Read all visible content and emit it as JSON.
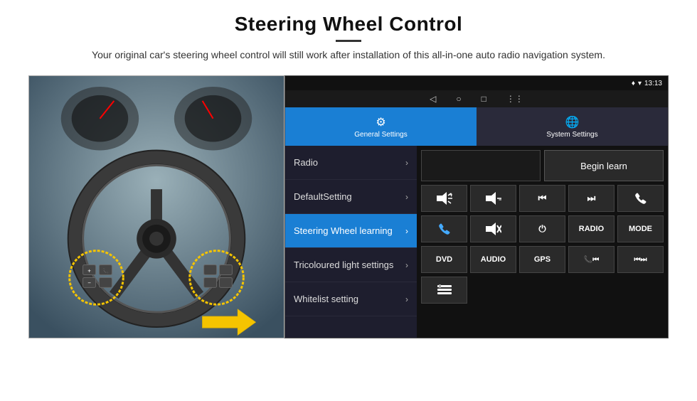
{
  "page": {
    "title": "Steering Wheel Control",
    "subtitle": "Your original car's steering wheel control will still work after installation of this all-in-one auto radio navigation system."
  },
  "status_bar": {
    "location_icon": "♦",
    "wifi_icon": "▼",
    "time": "13:13"
  },
  "nav_bar": {
    "back_icon": "◁",
    "home_icon": "○",
    "recent_icon": "□",
    "menu_icon": "⋮"
  },
  "tabs": [
    {
      "id": "general",
      "label": "General Settings",
      "icon": "⚙",
      "active": true
    },
    {
      "id": "system",
      "label": "System Settings",
      "icon": "⚙",
      "active": false
    }
  ],
  "menu_items": [
    {
      "label": "Radio",
      "active": false
    },
    {
      "label": "DefaultSetting",
      "active": false
    },
    {
      "label": "Steering Wheel learning",
      "active": true
    },
    {
      "label": "Tricoloured light settings",
      "active": false
    },
    {
      "label": "Whitelist setting",
      "active": false
    }
  ],
  "controls": {
    "begin_learn_label": "Begin learn",
    "row1": [
      {
        "icon": "🔊+",
        "label": "vol+"
      },
      {
        "icon": "🔊−",
        "label": "vol-"
      },
      {
        "icon": "⏮",
        "label": "prev"
      },
      {
        "icon": "⏭",
        "label": "next"
      },
      {
        "icon": "📞",
        "label": "call"
      }
    ],
    "row2": [
      {
        "icon": "📞",
        "label": "answer"
      },
      {
        "icon": "🔇",
        "label": "mute"
      },
      {
        "icon": "⏻",
        "label": "power"
      },
      {
        "icon": "RADIO",
        "label": "radio"
      },
      {
        "icon": "MODE",
        "label": "mode"
      }
    ],
    "row3": [
      {
        "icon": "DVD",
        "label": "dvd"
      },
      {
        "icon": "AUDIO",
        "label": "audio"
      },
      {
        "icon": "GPS",
        "label": "gps"
      },
      {
        "icon": "📞⏮",
        "label": "tel-prev"
      },
      {
        "icon": "⏮⏭",
        "label": "prev-next"
      }
    ],
    "row4": [
      {
        "icon": "📋",
        "label": "list"
      }
    ]
  }
}
